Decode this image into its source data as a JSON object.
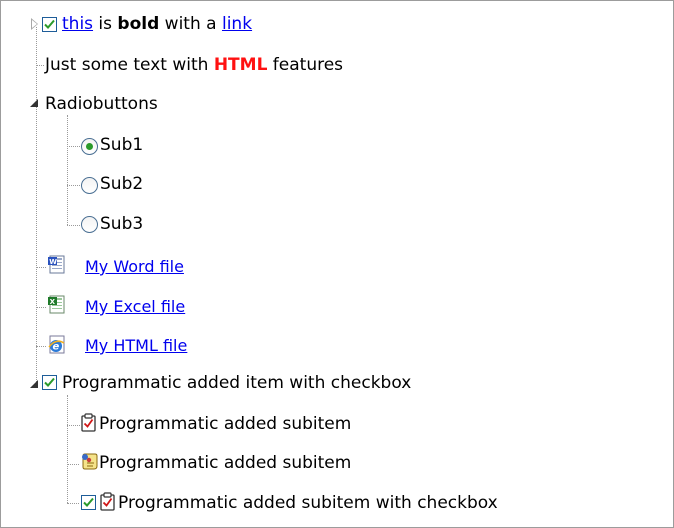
{
  "tree": {
    "item1": {
      "checked": true,
      "link_text": "this",
      "text_is": " is ",
      "bold_text": "bold",
      "text_with": " with a ",
      "link2_text": "link"
    },
    "item2": {
      "text_before": "Just some text with ",
      "html_text": "HTML",
      "text_after": " features"
    },
    "item3": {
      "label": "Radiobuttons",
      "children": [
        {
          "label": "Sub1",
          "selected": true
        },
        {
          "label": "Sub2",
          "selected": false
        },
        {
          "label": "Sub3",
          "selected": false
        }
      ]
    },
    "item4": {
      "label": "My Word file",
      "icon": "word-document-icon"
    },
    "item5": {
      "label": "My Excel file",
      "icon": "excel-document-icon"
    },
    "item6": {
      "label": "My HTML file",
      "icon": "html-document-icon"
    },
    "item7": {
      "label": "Programmatic added item with checkbox",
      "checked": true,
      "children": [
        {
          "label": "Programmatic added subitem",
          "icon": "clipboard-check-icon"
        },
        {
          "label": "Programmatic added subitem",
          "icon": "scroll-script-icon"
        },
        {
          "label": "Programmatic added subitem with checkbox",
          "icon": "clipboard-check-icon",
          "checked": true
        }
      ]
    }
  },
  "colors": {
    "link": "#0000ee",
    "html_highlight": "#ff1111",
    "check": "#2b9a2b",
    "connector": "#9a9a9a"
  }
}
